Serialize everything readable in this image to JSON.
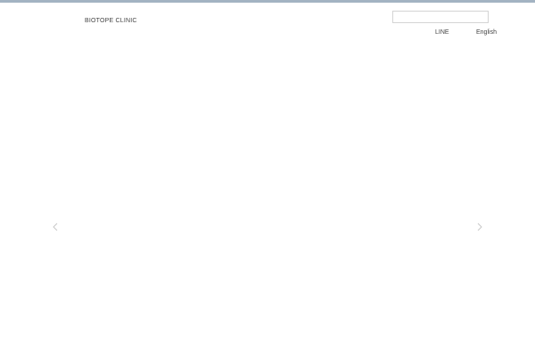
{
  "header": {
    "logo_text": "BIOTOPE CLINIC",
    "search": {
      "value": "",
      "placeholder": ""
    },
    "nav": [
      {
        "label": "LINE"
      },
      {
        "label": "English"
      }
    ]
  },
  "slider": {
    "prev_icon": "chevron-left-icon",
    "next_icon": "chevron-right-icon"
  },
  "colors": {
    "top_bar": "#a3b3c2",
    "text": "#444444",
    "arrow": "#c8c8c8"
  }
}
